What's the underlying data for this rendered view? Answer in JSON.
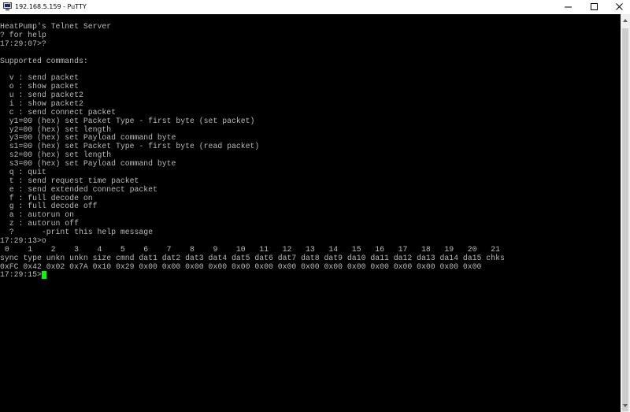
{
  "window": {
    "title": "192.168.5.159 - PuTTY",
    "controls": {
      "minimize": "minimize-icon",
      "maximize": "maximize-icon",
      "close": "close-icon"
    }
  },
  "colors": {
    "terminal_bg": "#000000",
    "terminal_fg": "#bbbbbb",
    "cursor": "#00ff00"
  },
  "terminal": {
    "lines": [
      "HeatPump's Telnet Server",
      "? for help",
      "17:29:07>?",
      "",
      "Supported commands:",
      "",
      "  v : send packet",
      "  o : show packet",
      "  u : send packet2",
      "  i : show packet2",
      "  c : send connect packet",
      "  y1=00 (hex) set Packet Type - first byte (set packet)",
      "  y2=00 (hex) set length",
      "  y3=00 (hex) set Payload command byte",
      "  s1=00 (hex) set Packet Type - first byte (read packet)",
      "  s2=00 (hex) set length",
      "  s3=00 (hex) set Payload command byte",
      "  q : quit",
      "  t : send request time packet",
      "  e : send extended connect packet",
      "  f : full decode on",
      "  g : full decode off",
      "  a : autorun on",
      "  z : autorun off",
      "  ?      -print this help message",
      "17:29:13>o",
      " 0    1    2    3    4    5    6    7    8    9    10   11   12   13   14   15   16   17   18   19   20   21",
      "sync type unkn unkn size cmnd dat1 dat2 dat3 dat4 dat5 dat6 dat7 dat8 dat9 da10 da11 da12 da13 da14 da15 chks",
      "0xFC 0x42 0x02 0x7A 0x10 0x29 0x00 0x00 0x00 0x00 0x00 0x00 0x00 0x00 0x00 0x00 0x00 0x00 0x00 0x00 0x00"
    ],
    "prompt": "17:29:15>"
  }
}
